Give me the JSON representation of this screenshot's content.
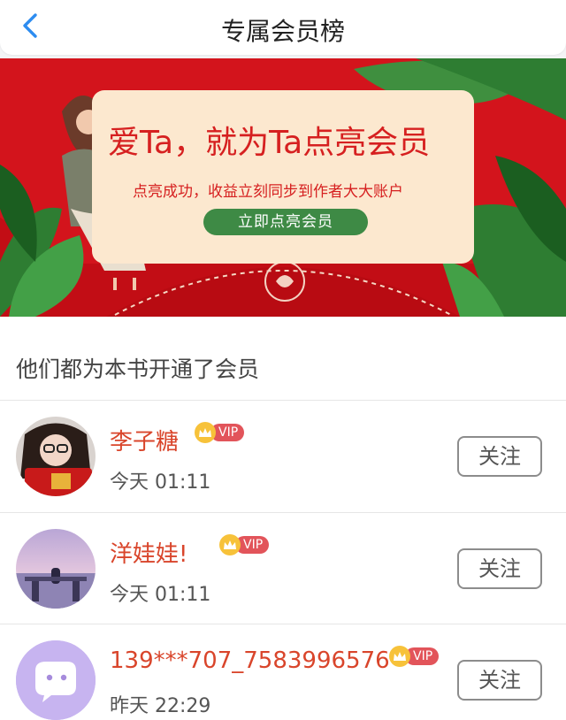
{
  "header": {
    "title": "专属会员榜"
  },
  "banner": {
    "headline": "爱Ta，就为Ta点亮会员",
    "subtitle": "点亮成功，收益立刻同步到作者大大账户",
    "cta_label": "立即点亮会员"
  },
  "members_section": {
    "title": "他们都为本书开通了会员",
    "members": [
      {
        "name": "李子糖",
        "vip_label": "VIP",
        "time": "今天 01:11",
        "follow_label": "关注"
      },
      {
        "name": "洋娃娃!",
        "vip_label": "VIP",
        "time": "今天 01:11",
        "follow_label": "关注"
      },
      {
        "name": "139***707_7583996576",
        "vip_label": "VIP",
        "time": "昨天 22:29",
        "follow_label": "关注"
      }
    ]
  },
  "colors": {
    "accent_blue": "#2d8cf0",
    "banner_red": "#d3141c",
    "username_orange": "#d9452b",
    "cta_green": "#3e8a45",
    "vip_pink": "#e2545a"
  },
  "icons": {
    "back": "chevron-left-icon",
    "vip": "crown-icon",
    "default_avatar": "chat-bubble-icon"
  }
}
